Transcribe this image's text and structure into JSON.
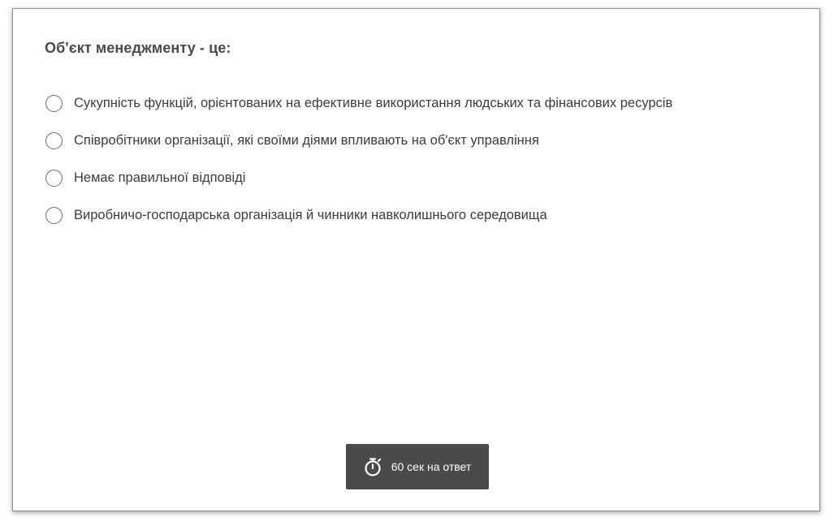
{
  "question": {
    "text": "Об'єкт менеджменту - це:"
  },
  "options": [
    {
      "label": "Сукупність функцій, орієнтованих на ефективне використання людських та фінансових ресурсів",
      "selected": false
    },
    {
      "label": "Співробітники організації, які своїми діями впливають на об'єкт управління",
      "selected": false
    },
    {
      "label": "Немає правильної відповіді",
      "selected": false
    },
    {
      "label": "Виробничо-господарська організація й чинники навколишнього середовища",
      "selected": false
    }
  ],
  "timer": {
    "icon": "stopwatch-icon",
    "label": "60 сек на ответ"
  },
  "colors": {
    "timer_background": "#4a4a4a",
    "card_border": "#8c8c8c",
    "text": "#3c3c3c"
  }
}
